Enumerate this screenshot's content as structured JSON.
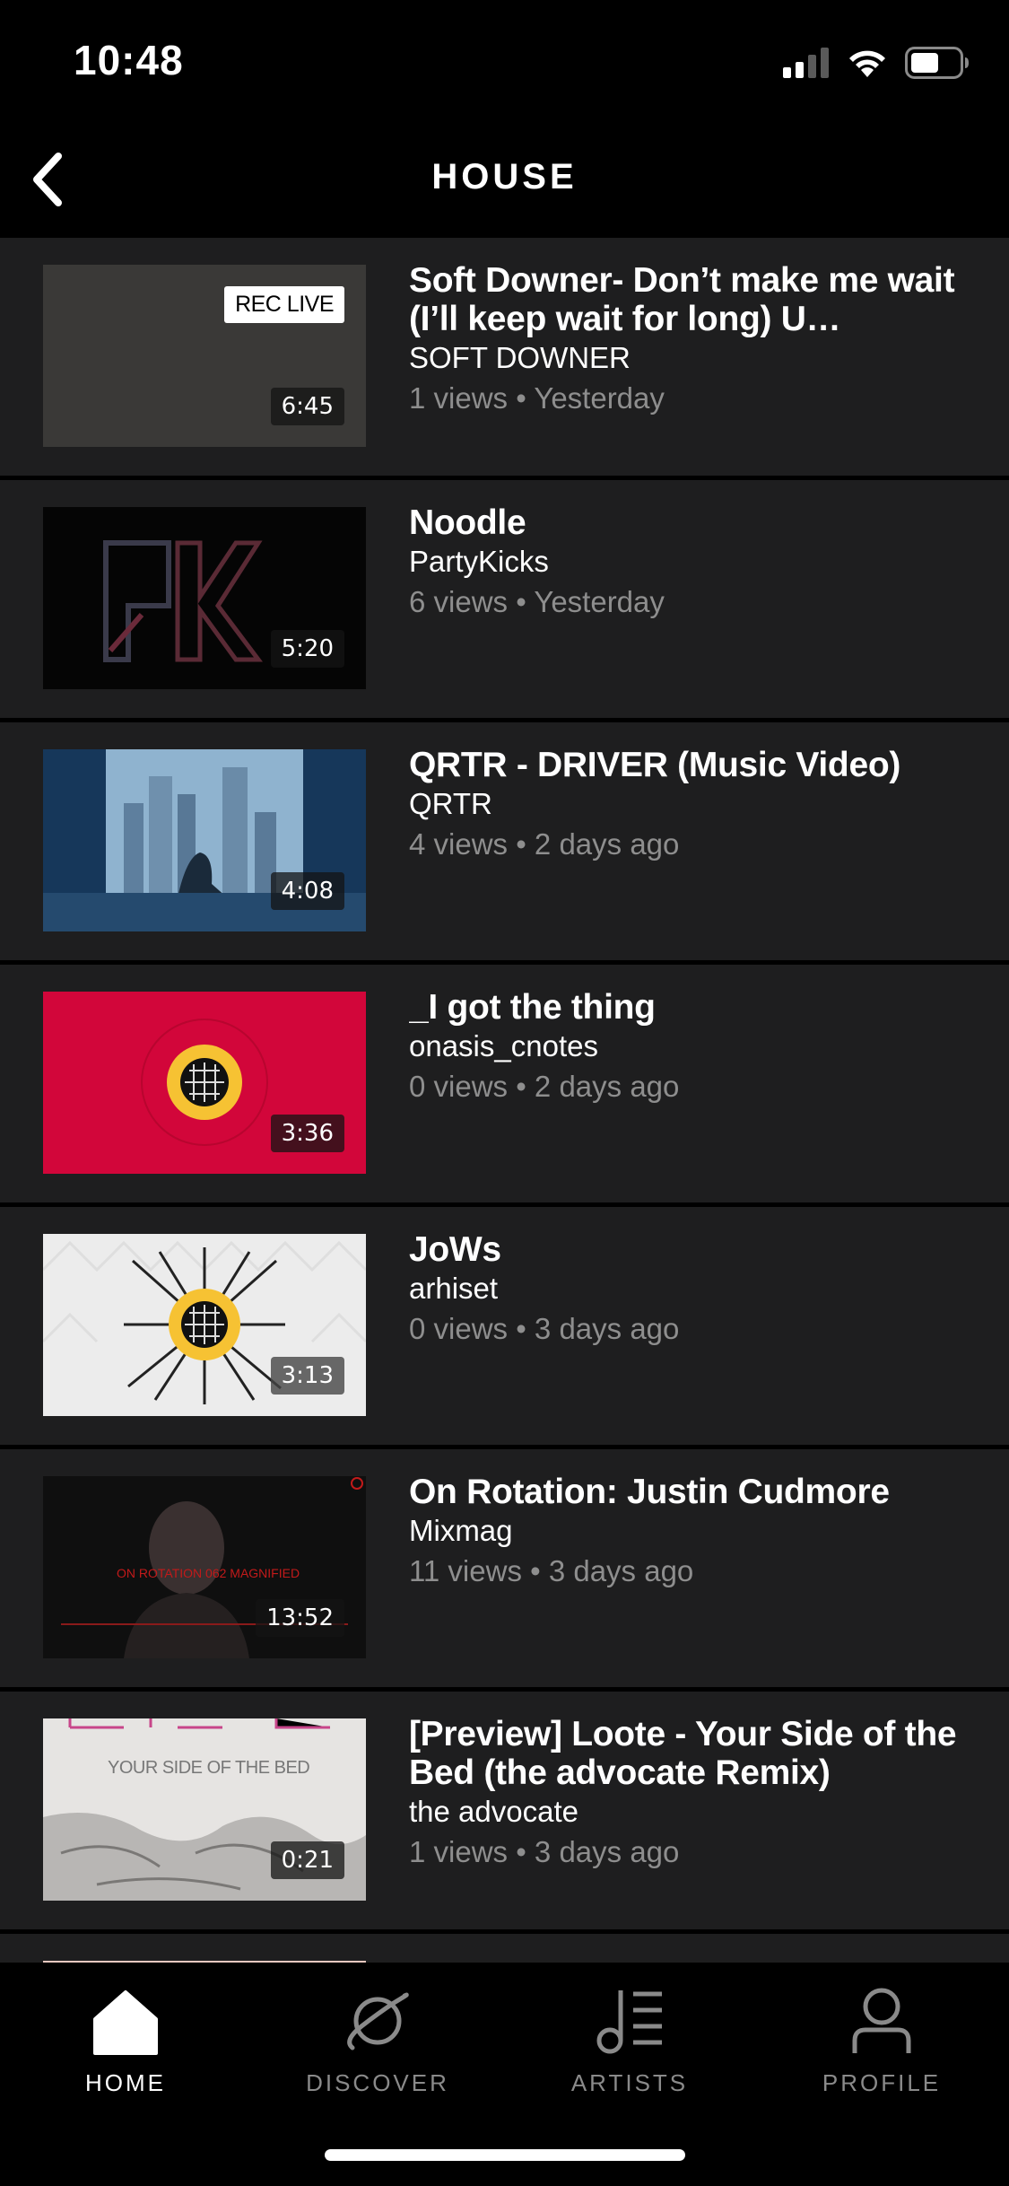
{
  "status_bar": {
    "time": "10:48"
  },
  "header": {
    "title": "HOUSE"
  },
  "videos": [
    {
      "title": "Soft Downer- Don’t make me wait (I’ll keep wait for long) U…",
      "channel": "SOFT DOWNER",
      "meta": "1 views • Yesterday",
      "duration": "6:45",
      "badge": "REC LIVE"
    },
    {
      "title": "Noodle",
      "channel": "PartyKicks",
      "meta": "6 views • Yesterday",
      "duration": "5:20"
    },
    {
      "title": "QRTR - DRIVER (Music Video)",
      "channel": "QRTR",
      "meta": "4 views • 2 days ago",
      "duration": "4:08"
    },
    {
      "title": "_I got the thing",
      "channel": "onasis_cnotes",
      "meta": "0 views • 2 days ago",
      "duration": "3:36"
    },
    {
      "title": "JoWs",
      "channel": "arhiset",
      "meta": "0 views • 3 days ago",
      "duration": "3:13"
    },
    {
      "title": "On Rotation: Justin Cudmore",
      "channel": "Mixmag",
      "meta": "11 views • 3 days ago",
      "duration": "13:52",
      "thumb_text": "ON ROTATION 062 MAGNIFIED"
    },
    {
      "title": "[Preview] Loote - Your Side of the Bed (the advocate Remix)",
      "channel": "the advocate",
      "meta": "1 views • 3 days ago",
      "duration": "0:21",
      "thumb_text": "YOUR SIDE OF THE BED"
    }
  ],
  "tabs": [
    {
      "label": "HOME",
      "icon": "home-icon",
      "active": true
    },
    {
      "label": "DISCOVER",
      "icon": "planet-icon",
      "active": false
    },
    {
      "label": "ARTISTS",
      "icon": "music-note-list-icon",
      "active": false
    },
    {
      "label": "PROFILE",
      "icon": "person-icon",
      "active": false
    }
  ],
  "colors": {
    "background": "#000000",
    "row": "#1e1e1f",
    "meta_text": "#8e8e8e",
    "accent_red": "#d2063a",
    "accent_yellow": "#f6c233"
  }
}
